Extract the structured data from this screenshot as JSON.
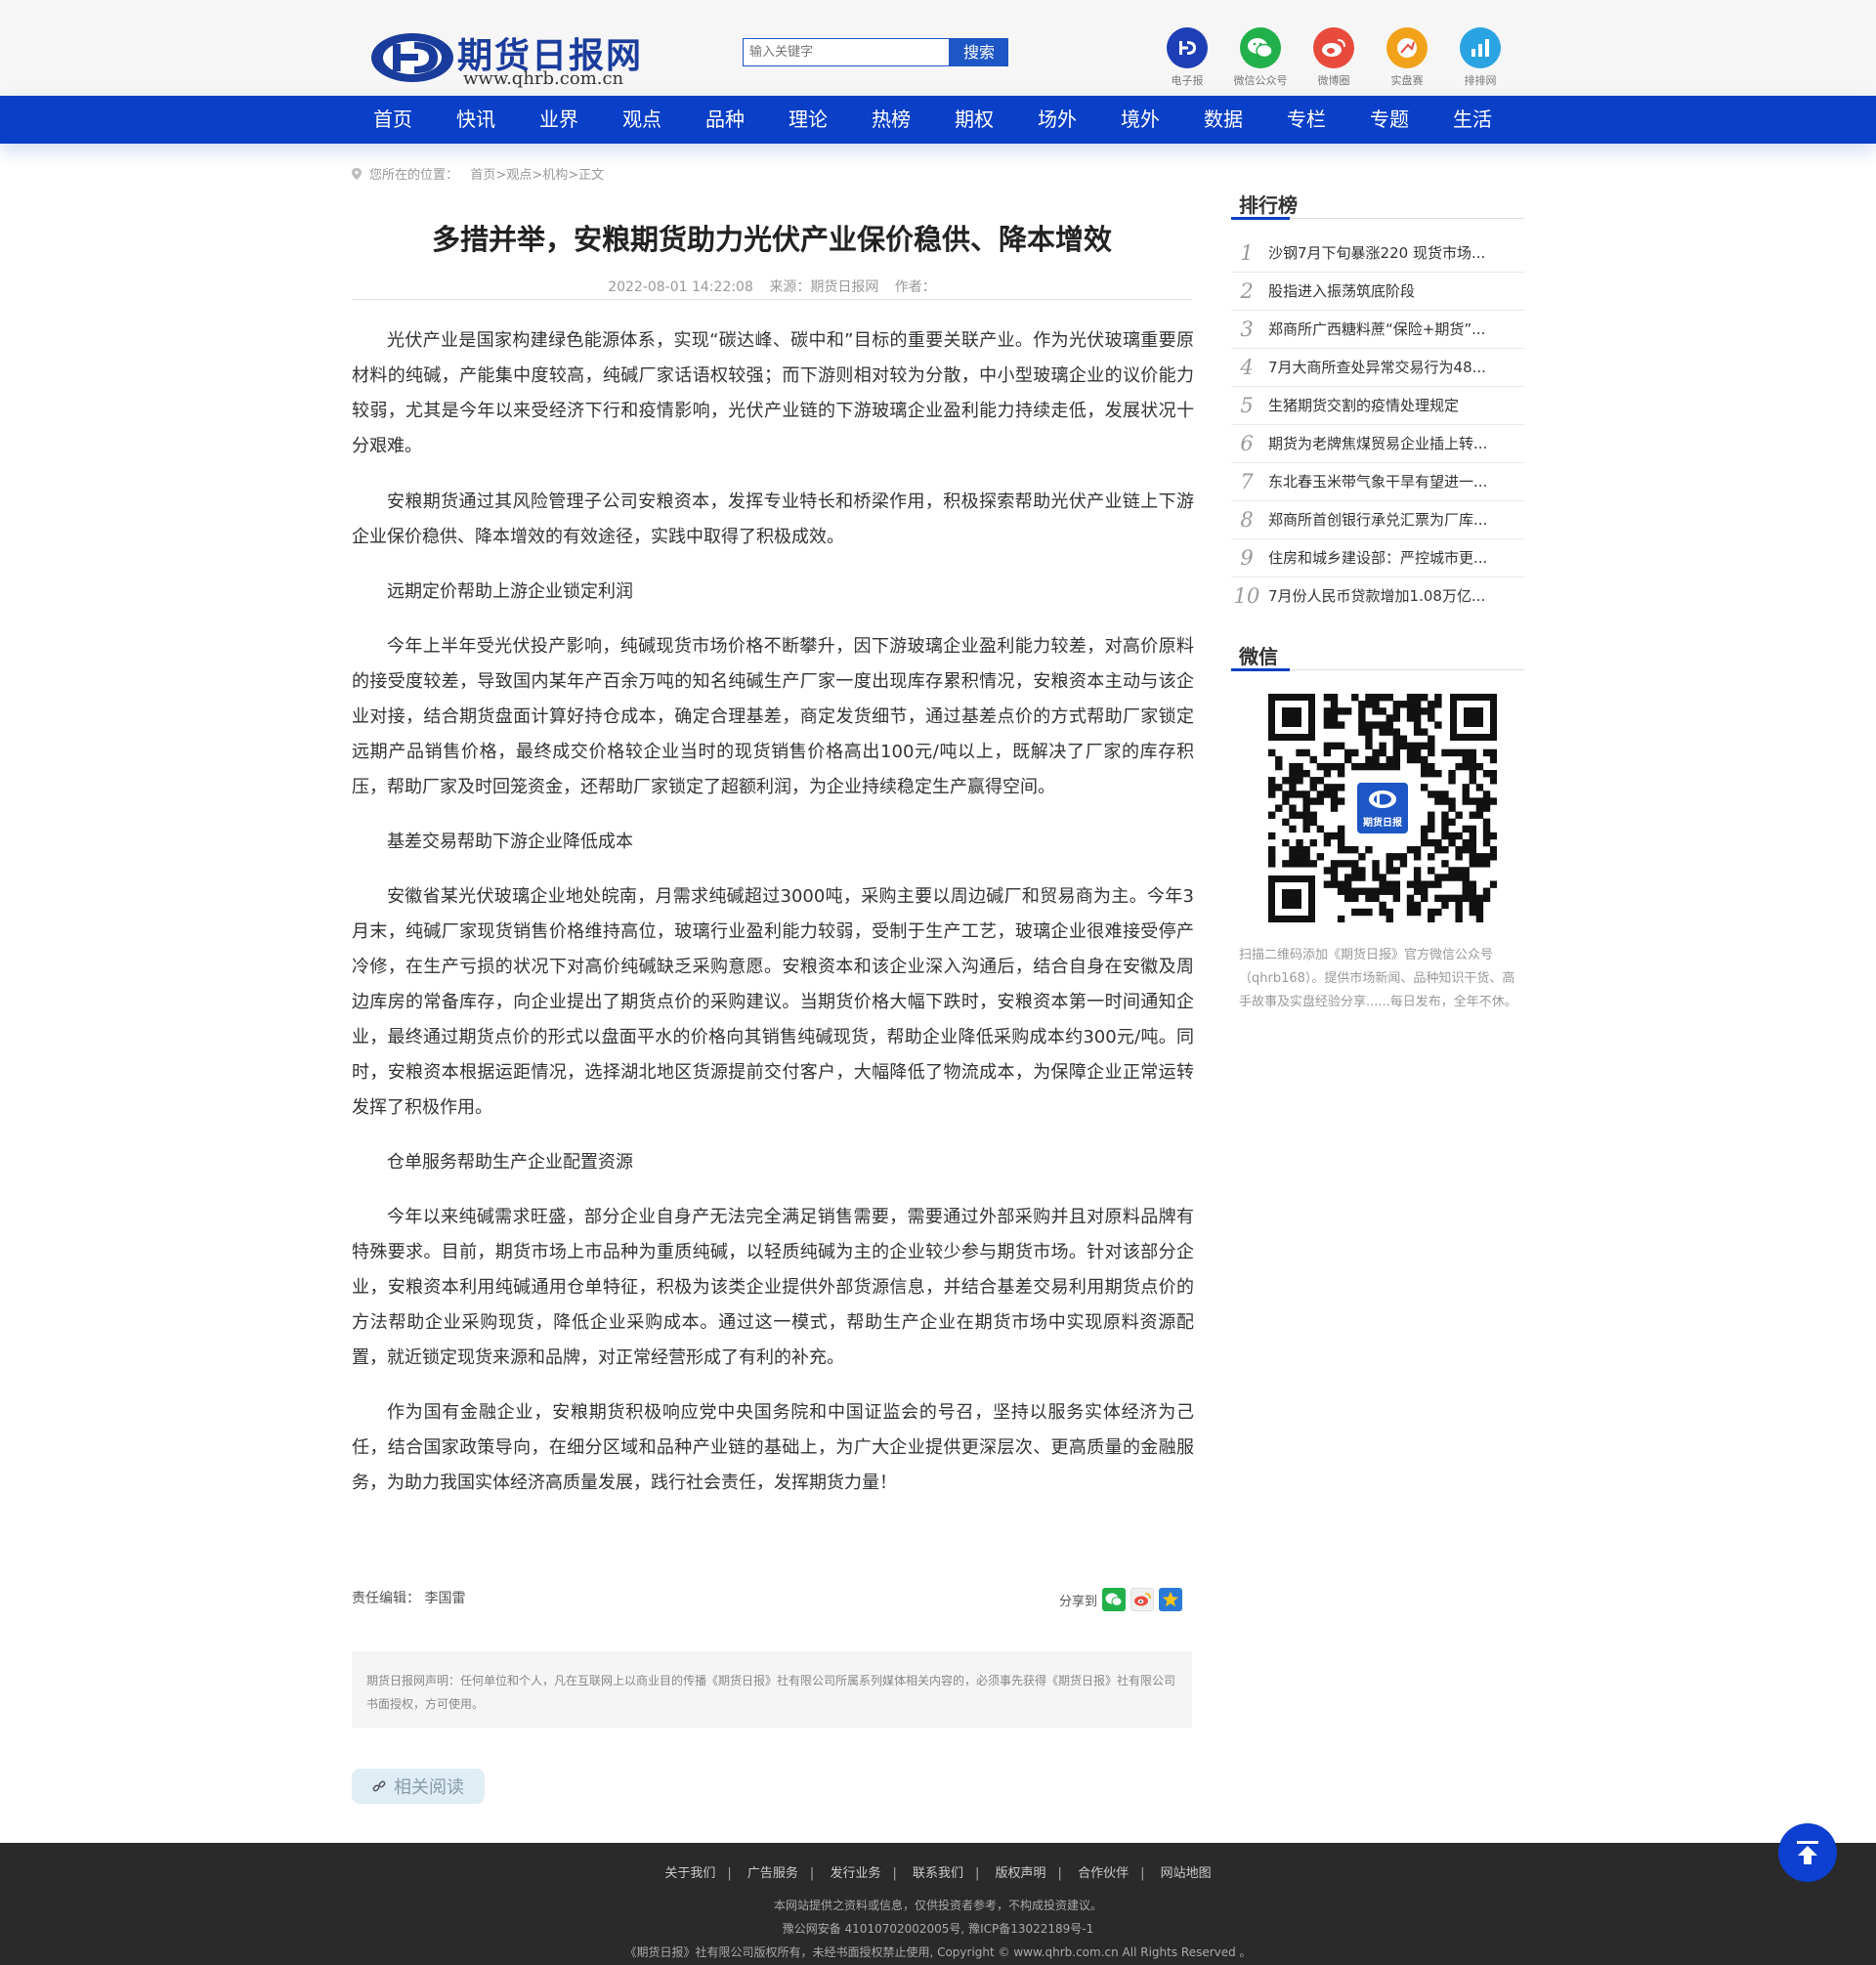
{
  "header": {
    "logo_text": "期货日报网",
    "logo_url": "www.qhrb.com.cn",
    "search_placeholder": "输入关键字",
    "search_label": "搜索",
    "icons": [
      {
        "label": "电子报",
        "icon": "hd-logo-icon",
        "color": "#1d3fb5"
      },
      {
        "label": "微信公众号",
        "icon": "wechat-icon",
        "color": "#22b04a"
      },
      {
        "label": "微博圈",
        "icon": "weibo-icon",
        "color": "#e84a3c"
      },
      {
        "label": "实盘赛",
        "icon": "trophy-icon",
        "color": "#f2a21a"
      },
      {
        "label": "排排网",
        "icon": "bar-chart-icon",
        "color": "#2aa3e3"
      }
    ]
  },
  "nav": [
    "首页",
    "快讯",
    "业界",
    "观点",
    "品种",
    "理论",
    "热榜",
    "期权",
    "场外",
    "境外",
    "数据",
    "专栏",
    "专题",
    "生活"
  ],
  "breadcrumb": {
    "prefix": "您所在的位置：",
    "path": "首页>观点>机构>正文"
  },
  "article": {
    "title": "多措并举，安粮期货助力光伏产业保价稳供、降本增效",
    "date": "2022-08-01 14:22:08",
    "source": "来源：期货日报网",
    "author": "作者：",
    "paragraphs": [
      "光伏产业是国家构建绿色能源体系，实现“碳达峰、碳中和”目标的重要关联产业。作为光伏玻璃重要原材料的纯碱，产能集中度较高，纯碱厂家话语权较强；而下游则相对较为分散，中小型玻璃企业的议价能力较弱，尤其是今年以来受经济下行和疫情影响，光伏产业链的下游玻璃企业盈利能力持续走低，发展状况十分艰难。",
      "安粮期货通过其风险管理子公司安粮资本，发挥专业特长和桥梁作用，积极探索帮助光伏产业链上下游企业保价稳供、降本增效的有效途径，实践中取得了积极成效。",
      "远期定价帮助上游企业锁定利润",
      "今年上半年受光伏投产影响，纯碱现货市场价格不断攀升，因下游玻璃企业盈利能力较差，对高价原料的接受度较差，导致国内某年产百余万吨的知名纯碱生产厂家一度出现库存累积情况，安粮资本主动与该企业对接，结合期货盘面计算好持仓成本，确定合理基差，商定发货细节，通过基差点价的方式帮助厂家锁定远期产品销售价格，最终成交价格较企业当时的现货销售价格高出100元/吨以上，既解决了厂家的库存积压，帮助厂家及时回笼资金，还帮助厂家锁定了超额利润，为企业持续稳定生产赢得空间。",
      "基差交易帮助下游企业降低成本",
      "安徽省某光伏玻璃企业地处皖南，月需求纯碱超过3000吨，采购主要以周边碱厂和贸易商为主。今年3月末，纯碱厂家现货销售价格维持高位，玻璃行业盈利能力较弱，受制于生产工艺，玻璃企业很难接受停产冷修，在生产亏损的状况下对高价纯碱缺乏采购意愿。安粮资本和该企业深入沟通后，结合自身在安徽及周边库房的常备库存，向企业提出了期货点价的采购建议。当期货价格大幅下跌时，安粮资本第一时间通知企业，最终通过期货点价的形式以盘面平水的价格向其销售纯碱现货，帮助企业降低采购成本约300元/吨。同时，安粮资本根据运距情况，选择湖北地区货源提前交付客户，大幅降低了物流成本，为保障企业正常运转发挥了积极作用。",
      "仓单服务帮助生产企业配置资源",
      "今年以来纯碱需求旺盛，部分企业自身产无法完全满足销售需要，需要通过外部采购并且对原料品牌有特殊要求。目前，期货市场上市品种为重质纯碱，以轻质纯碱为主的企业较少参与期货市场。针对该部分企业，安粮资本利用纯碱通用仓单特征，积极为该类企业提供外部货源信息，并结合基差交易利用期货点价的方法帮助企业采购现货，降低企业采购成本。通过这一模式，帮助生产企业在期货市场中实现原料资源配置，就近锁定现货来源和品牌，对正常经营形成了有利的补充。",
      "作为国有金融企业，安粮期货积极响应党中央国务院和中国证监会的号召，坚持以服务实体经济为己任，结合国家政策导向，在细分区域和品种产业链的基础上，为广大企业提供更深层次、更高质量的金融服务，为助力我国实体经济高质量发展，践行社会责任，发挥期货力量！"
    ],
    "editor": "责任编辑：  李国雷",
    "share_label": "分享到",
    "notice": "期货日报网声明：任何单位和个人，凡在互联网上以商业目的传播《期货日报》社有限公司所属系列媒体相关内容的，必须事先获得《期货日报》社有限公司书面授权，方可使用。",
    "related_label": "相关阅读"
  },
  "sidebar": {
    "rank_title": "排行榜",
    "rank": [
      {
        "num": "1",
        "title": "沙钢7月下旬暴涨220 现货市场..."
      },
      {
        "num": "2",
        "title": "股指进入振荡筑底阶段"
      },
      {
        "num": "3",
        "title": "郑商所广西糖料蔗“保险+期货”..."
      },
      {
        "num": "4",
        "title": "7月大商所查处异常交易行为48..."
      },
      {
        "num": "5",
        "title": "生猪期货交割的疫情处理规定"
      },
      {
        "num": "6",
        "title": "期货为老牌焦煤贸易企业插上转..."
      },
      {
        "num": "7",
        "title": "东北春玉米带气象干旱有望进一..."
      },
      {
        "num": "8",
        "title": "郑商所首创银行承兑汇票为厂库..."
      },
      {
        "num": "9",
        "title": "住房和城乡建设部：严控城市更..."
      },
      {
        "num": "10",
        "title": "7月份人民币贷款增加1.08万亿..."
      }
    ],
    "wechat_title": "微信",
    "qr_badge": "期货日报",
    "wechat_desc": "扫描二维码添加《期货日报》官方微信公众号（qhrb168）。提供市场新闻、品种知识干货、高手故事及实盘经验分享......每日发布，全年不休。"
  },
  "footer": {
    "links": [
      "关于我们",
      "广告服务",
      "发行业务",
      "联系我们",
      "版权声明",
      "合作伙伴",
      "网站地图"
    ],
    "line1": "本网站提供之资料或信息，仅供投资者参考，不构成投资建议。",
    "line2": "豫公网安备 41010702002005号, 豫ICP备13022189号-1",
    "line3": "《期货日报》社有限公司版权所有，未经书面授权禁止使用, Copyright © www.qhrb.com.cn All Rights Reserved 。"
  },
  "colors": {
    "nav_bg": "#0a3fc7",
    "accent": "#1d56c5",
    "footer_bg": "#2a2a2a"
  }
}
